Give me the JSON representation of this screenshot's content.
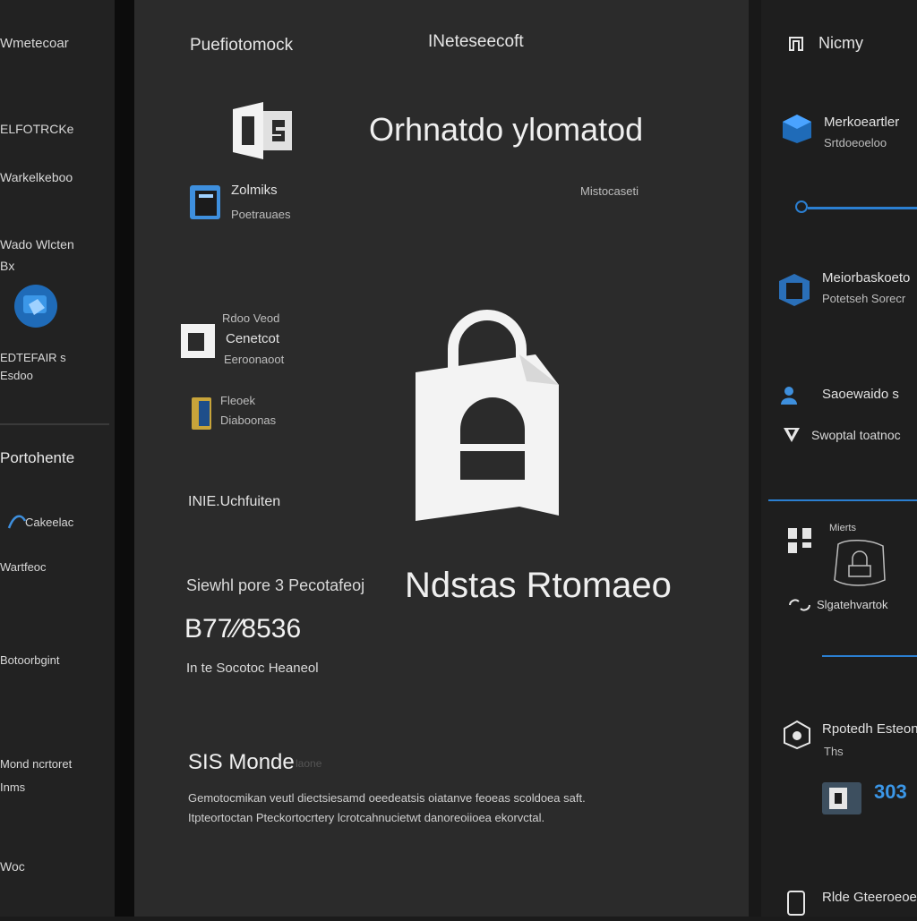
{
  "sidebar": {
    "items": [
      {
        "label": "Wmetecoar"
      },
      {
        "label": "ELFOTRCKe"
      },
      {
        "label": "Warkelkeboo"
      },
      {
        "label": "Wado Wlcten"
      },
      {
        "label": "Bx"
      },
      {
        "label": "EDTEFAIR s"
      },
      {
        "label": "Esdoo"
      },
      {
        "label": "Portohente"
      },
      {
        "label": "Cakeelac"
      },
      {
        "label": "Wartfeoc"
      },
      {
        "label": "Botoorbgint"
      },
      {
        "label": "Mond ncrtoret"
      },
      {
        "label": "Inms"
      },
      {
        "label": "Woc"
      }
    ]
  },
  "header": {
    "tab_left": "Puefiotomock",
    "tab_center": "INeteseecoft"
  },
  "main": {
    "hero_title": "Orhnatdo ylomatod",
    "hero_sub": "Mistocaseti",
    "tile1": {
      "line1": "Zolmiks",
      "line2": "Poetrauaes"
    },
    "tile2": {
      "line1": "Rdoo Veod",
      "line2": "Cenetcot",
      "line3": "Eeroonaoot"
    },
    "tile3": {
      "line1": "Fleoek",
      "line2": "Diaboonas"
    },
    "section_label": "INIE.Uchfuiten",
    "banner_prefix": "Siewhl pore 3 Pecotafeoj",
    "banner_big": "Ndstas Rtomaeo",
    "code": "B77⁄⁄8536",
    "code_caption": "In te Socotoc Heaneol",
    "footer_title": "SIS Monde",
    "footer_title_dim": "laone",
    "paragraph_line1": "Gemotocmikan veutl diectsiesamd oeedeatsis oiatanve feoeas scoldoea saft.",
    "paragraph_line2": "Itpteortoctan Pteckortocrtery lcrotcahnucietwt danoreoiioea ekorvctal."
  },
  "right_panel": {
    "header": "Nicmy",
    "item1": {
      "line1": "Merkoeartler",
      "line2": "Srtdoeoeloo"
    },
    "item2": {
      "line1": "Meiorbaskoeto",
      "line2": "Potetseh Sorecr"
    },
    "item3": {
      "line1": "Saoewaido s"
    },
    "item4": {
      "line1": "Swoptal toatnoc"
    },
    "item5": {
      "line1": "Mierts"
    },
    "item6": {
      "line1": "Slgatehvartok"
    },
    "item7": {
      "line1": "Rpotedh Esteonaer",
      "line2": "Ths"
    },
    "badge_count": "303",
    "bottom_item": "Rlde Gteeroeoe"
  },
  "colors": {
    "accent": "#2b7fd1",
    "background_main": "#2b2b2b",
    "background_side": "#222222"
  }
}
